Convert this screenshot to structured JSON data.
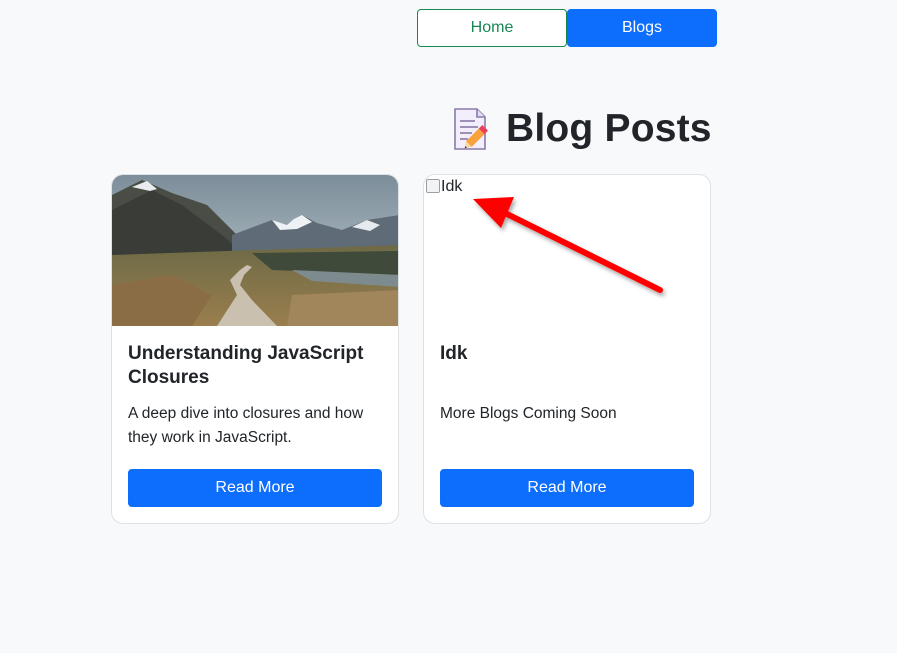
{
  "nav": {
    "home_label": "Home",
    "blogs_label": "Blogs"
  },
  "page": {
    "title_icon": "memo-pencil-icon",
    "title": "Blog Posts"
  },
  "cards": [
    {
      "image": "mountain-boardwalk-photo",
      "title": "Understanding JavaScript Closures",
      "description": "A deep dive into closures and how they work in JavaScript.",
      "button_label": "Read More"
    },
    {
      "image_alt": "Idk",
      "title": "Idk",
      "description": "More Blogs Coming Soon",
      "button_label": "Read More"
    }
  ],
  "annotation": {
    "arrow_color": "#ff0000"
  },
  "colors": {
    "primary": "#0d6efd",
    "success": "#198754",
    "background": "#f8f9fa"
  }
}
